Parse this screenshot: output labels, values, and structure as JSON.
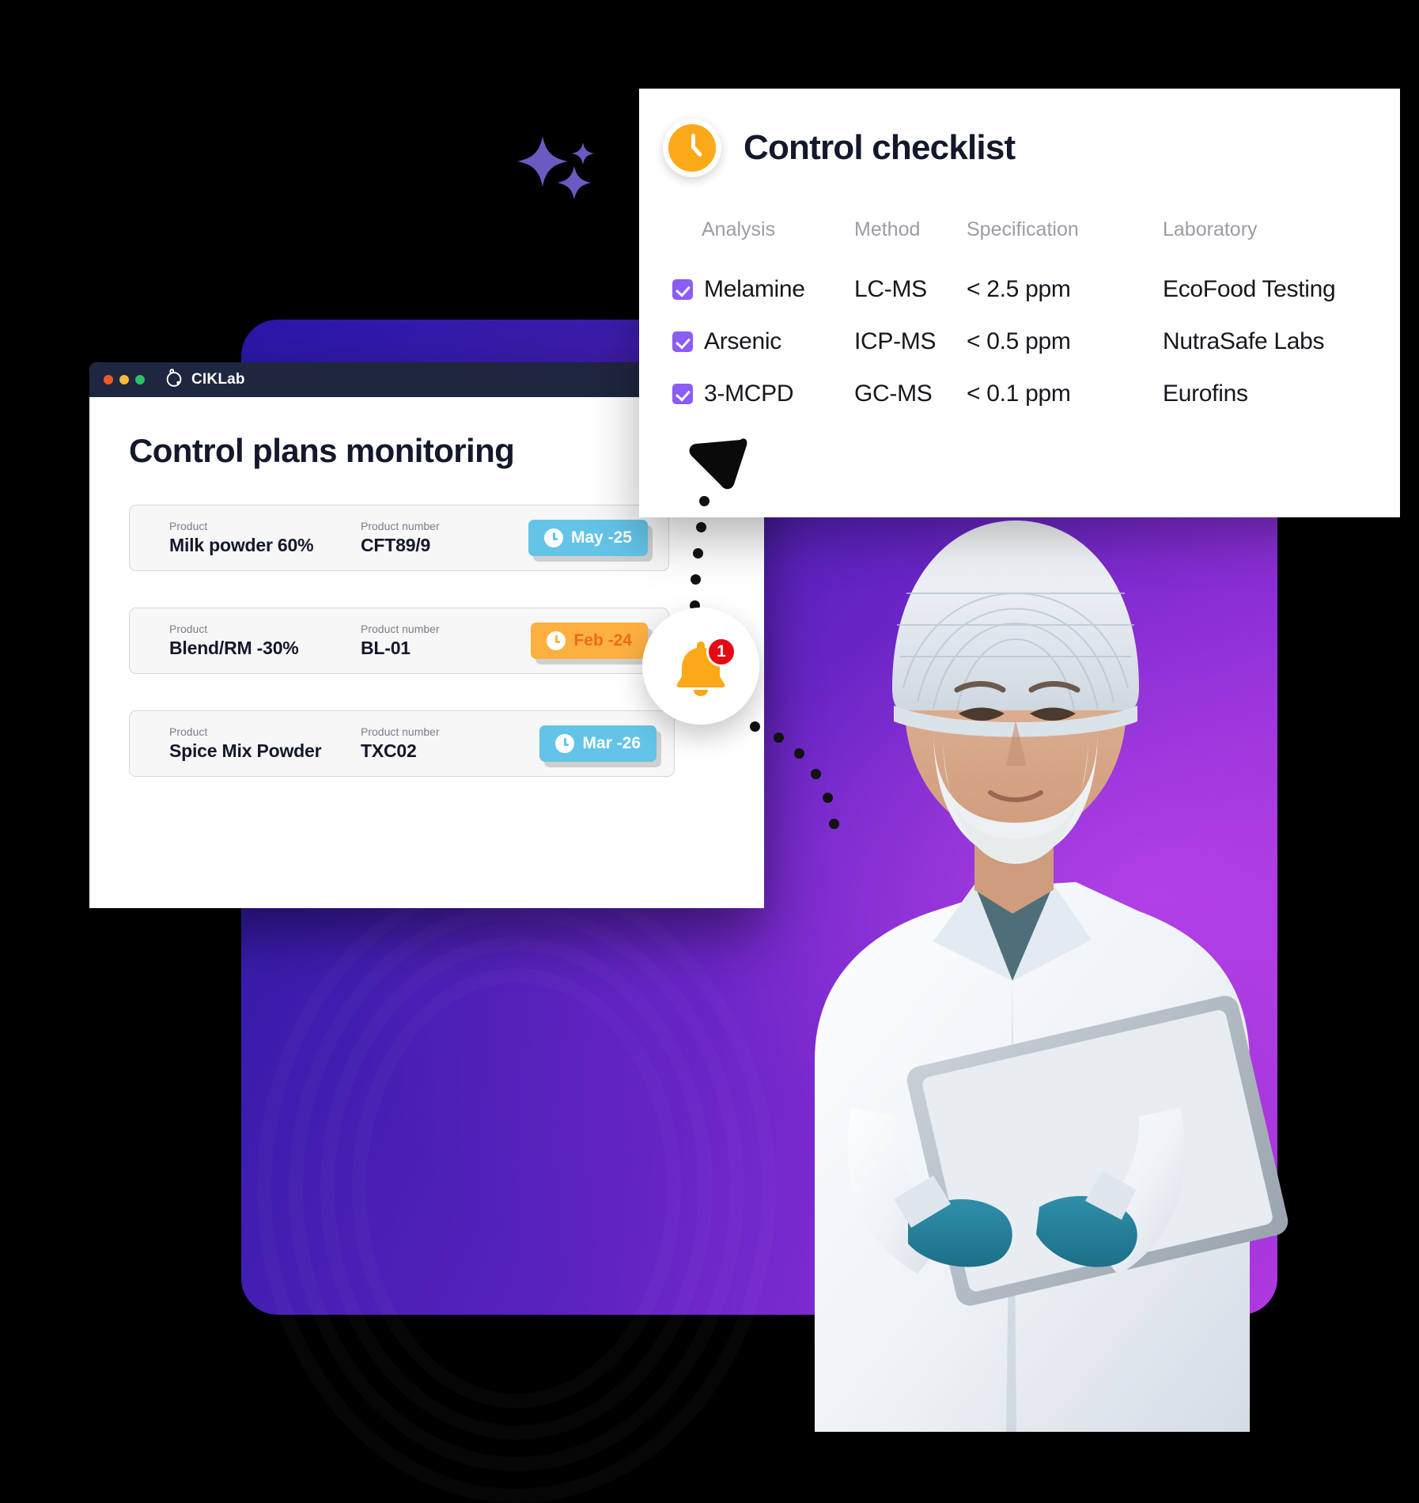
{
  "brand": {
    "name": "CIKLab",
    "logo_icon": "atom-circle-logo"
  },
  "window_controls": {
    "close": "close-dot",
    "minimize": "minimize-dot",
    "maximize": "maximize-dot"
  },
  "app": {
    "page_title": "Control plans monitoring",
    "labels": {
      "product": "Product",
      "product_number": "Product number"
    },
    "control_plans": [
      {
        "product": "Milk powder 60%",
        "product_number": "CFT89/9",
        "due": "May -25",
        "due_style": "blue",
        "icon": "clock-icon"
      },
      {
        "product": "Blend/RM -30%",
        "product_number": "BL-01",
        "due": "Feb -24",
        "due_style": "orange",
        "icon": "clock-icon"
      },
      {
        "product": "Spice Mix Powder",
        "product_number": "TXC02",
        "due": "Mar -26",
        "due_style": "blue",
        "icon": "clock-icon"
      }
    ]
  },
  "checklist": {
    "title": "Control checklist",
    "icon": "clock-icon",
    "columns": [
      "Analysis",
      "Method",
      "Specification",
      "Laboratory"
    ],
    "rows": [
      {
        "checked": true,
        "analysis": "Melamine",
        "method": "LC-MS",
        "specification": "< 2.5 ppm",
        "laboratory": "EcoFood Testing"
      },
      {
        "checked": true,
        "analysis": "Arsenic",
        "method": "ICP-MS",
        "specification": "< 0.5 ppm",
        "laboratory": "NutraSafe Labs"
      },
      {
        "checked": true,
        "analysis": "3-MCPD",
        "method": "GC-MS",
        "specification": "< 0.1 ppm",
        "laboratory": "Eurofins"
      }
    ]
  },
  "notification": {
    "count": "1",
    "icon": "bell-icon"
  },
  "colors": {
    "accent_purple": "#8B5CF6",
    "badge_blue": "#63c4e8",
    "badge_orange": "#fcb040",
    "badge_orange_text": "#ef6a1c",
    "clock_yellow": "#FBA919",
    "alert_red": "#e50914",
    "titlebar": "#1e2640",
    "text_dark": "#14182b"
  }
}
